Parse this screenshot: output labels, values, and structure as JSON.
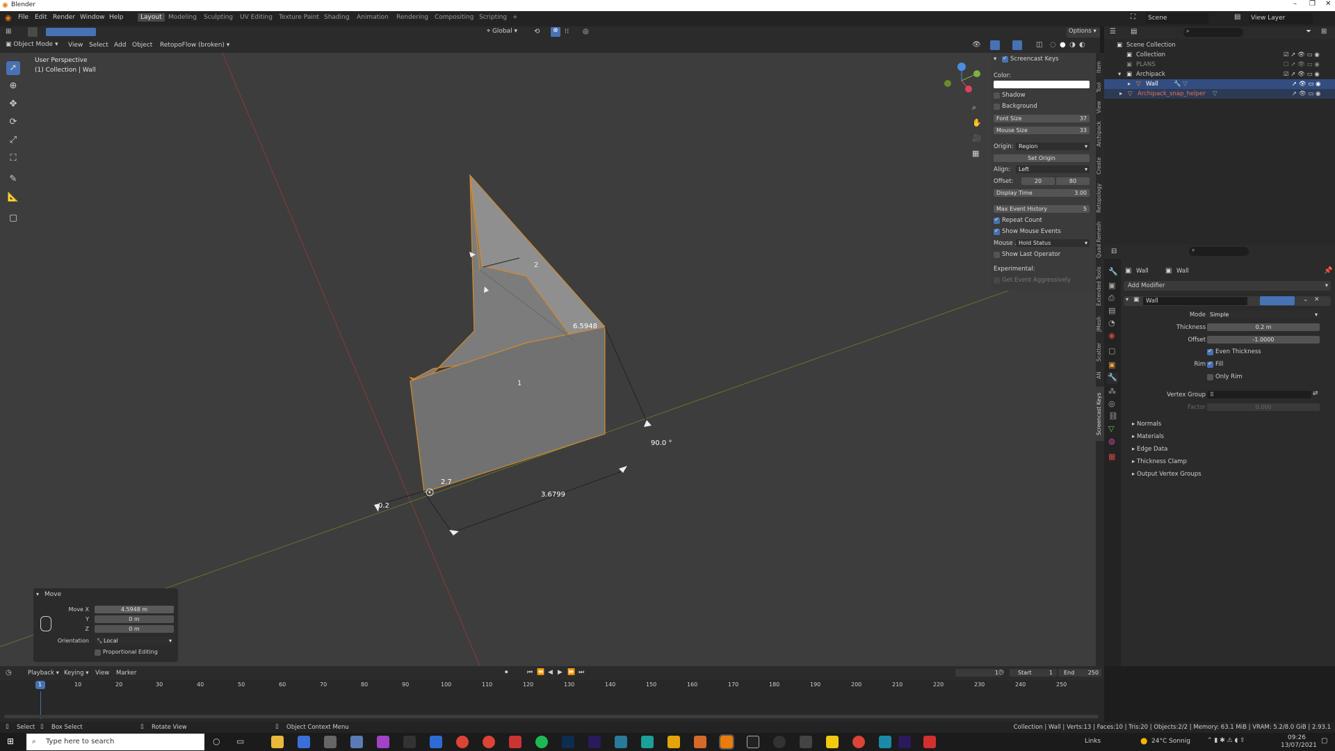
{
  "app": {
    "title": "Blender",
    "taskbar_search": "Type here to search",
    "weather": "24°C Sonnig",
    "time": "09:26",
    "date": "13/07/2021",
    "links": "Links"
  },
  "menus": [
    "File",
    "Edit",
    "Render",
    "Window",
    "Help"
  ],
  "workspaces": [
    "Layout",
    "Modeling",
    "Sculpting",
    "UV Editing",
    "Texture Paint",
    "Shading",
    "Animation",
    "Rendering",
    "Compositing",
    "Scripting"
  ],
  "header": {
    "mode": "Object Mode",
    "view": "View",
    "select": "Select",
    "add": "Add",
    "object": "Object",
    "retopo": "RetopoFlow (broken)",
    "transform": "Global",
    "options": "Options"
  },
  "viewport": {
    "perspective": "User Perspective",
    "collection": "(1) Collection | Wall",
    "dims": [
      "2",
      "6.5948",
      "1",
      "90.0 °",
      "2.7",
      "3.6799",
      "0.2"
    ]
  },
  "screencast": {
    "title": "Screencast Keys",
    "color_label": "Color:",
    "shadow": "Shadow",
    "background": "Background",
    "font_size_label": "Font Size",
    "font_size": "37",
    "mouse_size_label": "Mouse Size",
    "mouse_size": "33",
    "origin_label": "Origin:",
    "origin": "Region",
    "set_origin": "Set Origin",
    "align_label": "Align:",
    "align": "Left",
    "offset_label": "Offset:",
    "offset_x": "20",
    "offset_y": "80",
    "display_time_label": "Display Time",
    "display_time": "3.00",
    "max_event_label": "Max Event History",
    "max_event": "5",
    "repeat_count": "Repeat Count",
    "show_mouse": "Show Mouse Events",
    "mouse_label": "Mouse ...",
    "hold_status": "Hold Status",
    "show_last": "Show Last Operator",
    "experimental": "Experimental:",
    "get_event": "Get Event Aggressively"
  },
  "vtabs": [
    "Item",
    "Tool",
    "View",
    "Archipack",
    "Create",
    "Retopology",
    "Quad Remesh",
    "Extended Tools",
    "JMesh",
    "Scatter",
    "AN",
    "Screencast Keys"
  ],
  "outliner": {
    "scene": "Scene",
    "view_layer": "View Layer",
    "scene_collection": "Scene Collection",
    "items": [
      "Collection",
      "PLANS",
      "Archipack",
      "Wall",
      "Archipack_snap_helper"
    ]
  },
  "properties": {
    "obj1": "Wall",
    "obj2": "Wall",
    "add_modifier": "Add Modifier",
    "modifier_name": "Wall",
    "mode_label": "Mode",
    "mode": "Simple",
    "thickness_label": "Thickness",
    "thickness": "0.2 m",
    "offset_label": "Offset",
    "offset": "-1.0000",
    "even": "Even Thickness",
    "rim_label": "Rim",
    "fill": "Fill",
    "only_rim": "Only Rim",
    "vgroup_label": "Vertex Group",
    "factor_label": "Factor",
    "factor": "0.000",
    "sections": [
      "Normals",
      "Materials",
      "Edge Data",
      "Thickness Clamp",
      "Output Vertex Groups"
    ]
  },
  "move_panel": {
    "title": "Move",
    "move_x_label": "Move X",
    "move_x": "4.5948 m",
    "y_label": "Y",
    "y": "0 m",
    "z_label": "Z",
    "z": "0 m",
    "orient_label": "Orientation",
    "orient": "Local",
    "prop_edit": "Proportional Editing"
  },
  "timeline": {
    "playback": "Playback",
    "keying": "Keying",
    "view": "View",
    "marker": "Marker",
    "frame": "1",
    "start_label": "Start",
    "start": "1",
    "end_label": "End",
    "end": "250",
    "ticks": [
      "1",
      "10",
      "20",
      "30",
      "40",
      "50",
      "60",
      "70",
      "80",
      "90",
      "100",
      "110",
      "120",
      "130",
      "140",
      "150",
      "160",
      "170",
      "180",
      "190",
      "200",
      "210",
      "220",
      "230",
      "240",
      "250"
    ]
  },
  "status": {
    "select": "Select",
    "box_select": "Box Select",
    "rotate_view": "Rotate View",
    "context_menu": "Object Context Menu",
    "stats": "Collection | Wall | Verts:13 | Faces:10 | Tris:20 | Objects:2/2 | Memory: 63.1 MiB | VRAM: 5.2/8.0 GiB | 2.93.1"
  }
}
